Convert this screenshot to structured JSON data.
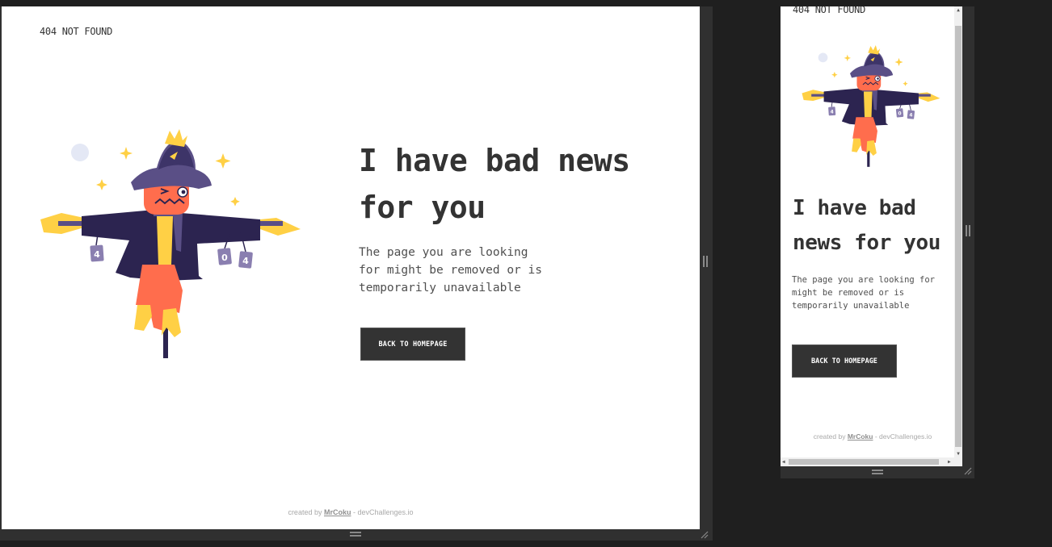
{
  "desktop": {
    "brand": "404 NOT FOUND",
    "headline_line1": "I have bad news",
    "headline_line2": "for you",
    "desc_line1": "The page you are looking",
    "desc_line2": "for might be removed or is",
    "desc_line3": "temporarily unavailable",
    "button_label": "BACK TO HOMEPAGE",
    "credit_prefix": "created by",
    "credit_author": "MrCoku",
    "credit_suffix": "- devChallenges.io",
    "illustration": "scarecrow-illustration"
  },
  "mobile": {
    "brand": "404 NOT FOUND",
    "headline_line1": "I have bad",
    "headline_line2": "news for you",
    "desc_line1": "The page you are looking for",
    "desc_line2": "might be removed or is",
    "desc_line3": "temporarily unavailable",
    "button_label": "BACK TO HOMEPAGE",
    "credit_prefix": "created by",
    "credit_author": "MrCoku",
    "credit_suffix": "- devChallenges.io",
    "illustration": "scarecrow-illustration"
  },
  "sign_digits": [
    "4",
    "0",
    "4"
  ],
  "colors": {
    "text_dark": "#333333",
    "button_bg": "#333333",
    "coat": "#2c2450",
    "face": "#ff6d4d",
    "straw": "#ffd045",
    "sign": "#8a7fb0"
  },
  "icons": {
    "resize_handle_vertical": "drag-handle-icon",
    "resize_handle_horizontal": "drag-handle-icon",
    "corner_resize": "resize-corner-icon"
  }
}
